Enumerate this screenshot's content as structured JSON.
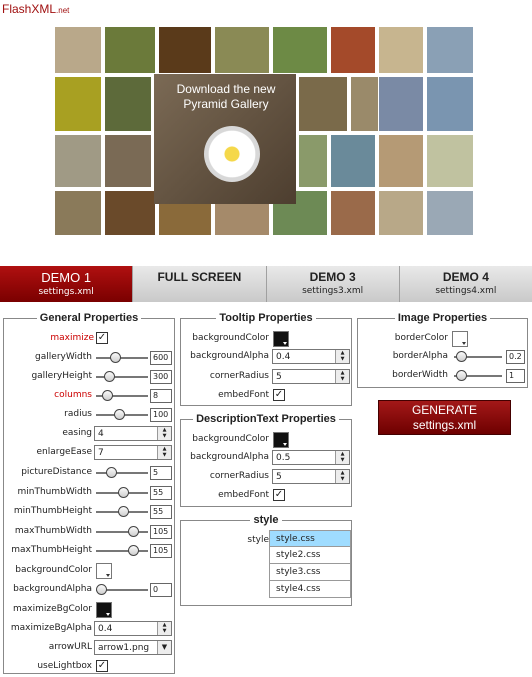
{
  "logo": {
    "main": "FlashXML",
    "suffix": ".net"
  },
  "gallery": {
    "overlay_text": "Download the new Pyramid Gallery"
  },
  "tabs": [
    {
      "title": "DEMO 1",
      "subtitle": "settings.xml"
    },
    {
      "title": "FULL SCREEN",
      "subtitle": ""
    },
    {
      "title": "DEMO 3",
      "subtitle": "settings3.xml"
    },
    {
      "title": "DEMO 4",
      "subtitle": "settings4.xml"
    }
  ],
  "general": {
    "title": "General Properties",
    "maximize": "maximize",
    "galleryWidth": {
      "label": "galleryWidth",
      "value": "600"
    },
    "galleryHeight": {
      "label": "galleryHeight",
      "value": "300"
    },
    "columns": {
      "label": "columns",
      "value": "8"
    },
    "radius": {
      "label": "radius",
      "value": "100"
    },
    "easing": {
      "label": "easing",
      "value": "4"
    },
    "enlargeEase": {
      "label": "enlargeEase",
      "value": "7"
    },
    "pictureDistance": {
      "label": "pictureDistance",
      "value": "5"
    },
    "minThumbWidth": {
      "label": "minThumbWidth",
      "value": "55"
    },
    "minThumbHeight": {
      "label": "minThumbHeight",
      "value": "55"
    },
    "maxThumbWidth": {
      "label": "maxThumbWidth",
      "value": "105"
    },
    "maxThumbHeight": {
      "label": "maxThumbHeight",
      "value": "105"
    },
    "backgroundColor": "backgroundColor",
    "backgroundAlpha": {
      "label": "backgroundAlpha",
      "value": "0"
    },
    "maximizeBgColor": "maximizeBgColor",
    "maximizeBgAlpha": {
      "label": "maximizeBgAlpha",
      "value": "0.4"
    },
    "arrowURL": {
      "label": "arrowURL",
      "value": "arrow1.png"
    },
    "useLightbox": "useLightbox"
  },
  "tooltip": {
    "title": "Tooltip Properties",
    "backgroundColor": "backgroundColor",
    "backgroundAlpha": {
      "label": "backgroundAlpha",
      "value": "0.4"
    },
    "cornerRadius": {
      "label": "cornerRadius",
      "value": "5"
    },
    "embedFont": "embedFont"
  },
  "description": {
    "title": "DescriptionText Properties",
    "backgroundColor": "backgroundColor",
    "backgroundAlpha": {
      "label": "backgroundAlpha",
      "value": "0.5"
    },
    "cornerRadius": {
      "label": "cornerRadius",
      "value": "5"
    },
    "embedFont": "embedFont"
  },
  "image": {
    "title": "Image Properties",
    "borderColor": "borderColor",
    "borderAlpha": {
      "label": "borderAlpha",
      "value": "0.2"
    },
    "borderWidth": {
      "label": "borderWidth",
      "value": "1"
    }
  },
  "generate": {
    "line1": "GENERATE",
    "line2": "settings.xml"
  },
  "style": {
    "title": "style",
    "label": "style",
    "options": [
      "style.css",
      "style2.css",
      "style3.css",
      "style4.css"
    ]
  },
  "colors": {
    "accent": "#a31818",
    "selected": "#9fdcff"
  }
}
